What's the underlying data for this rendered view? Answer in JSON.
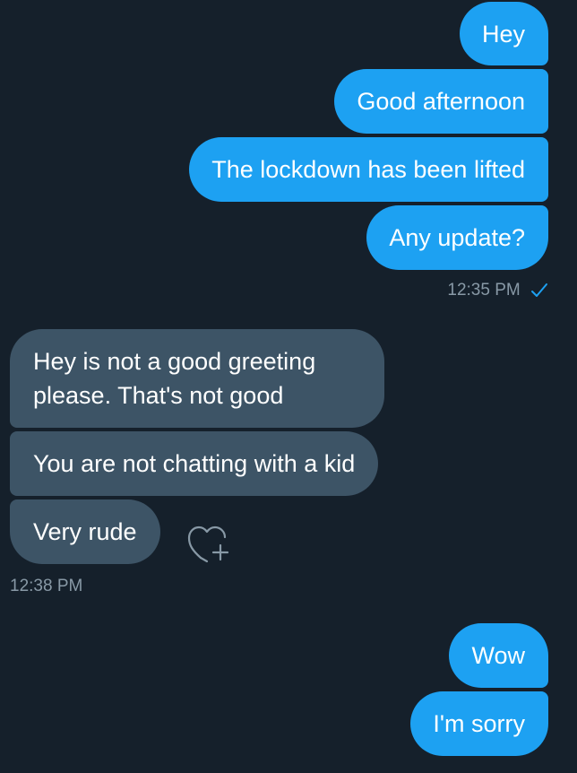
{
  "sent_group_1": {
    "messages": [
      "Hey",
      "Good afternoon",
      "The lockdown has been lifted",
      "Any update?"
    ],
    "timestamp": "12:35 PM"
  },
  "received_group": {
    "messages": [
      "Hey is not a good greeting please. That's not good",
      "You are not chatting with a kid",
      "Very rude"
    ],
    "timestamp": "12:38 PM"
  },
  "sent_group_2": {
    "messages": [
      "Wow",
      "I'm sorry"
    ]
  },
  "icons": {
    "read_receipt": "checkmark-icon",
    "react": "heart-add-icon"
  },
  "colors": {
    "background": "#15202b",
    "sent_bubble": "#1da1f2",
    "received_bubble": "#3d5466",
    "meta_text": "#8899a6"
  }
}
